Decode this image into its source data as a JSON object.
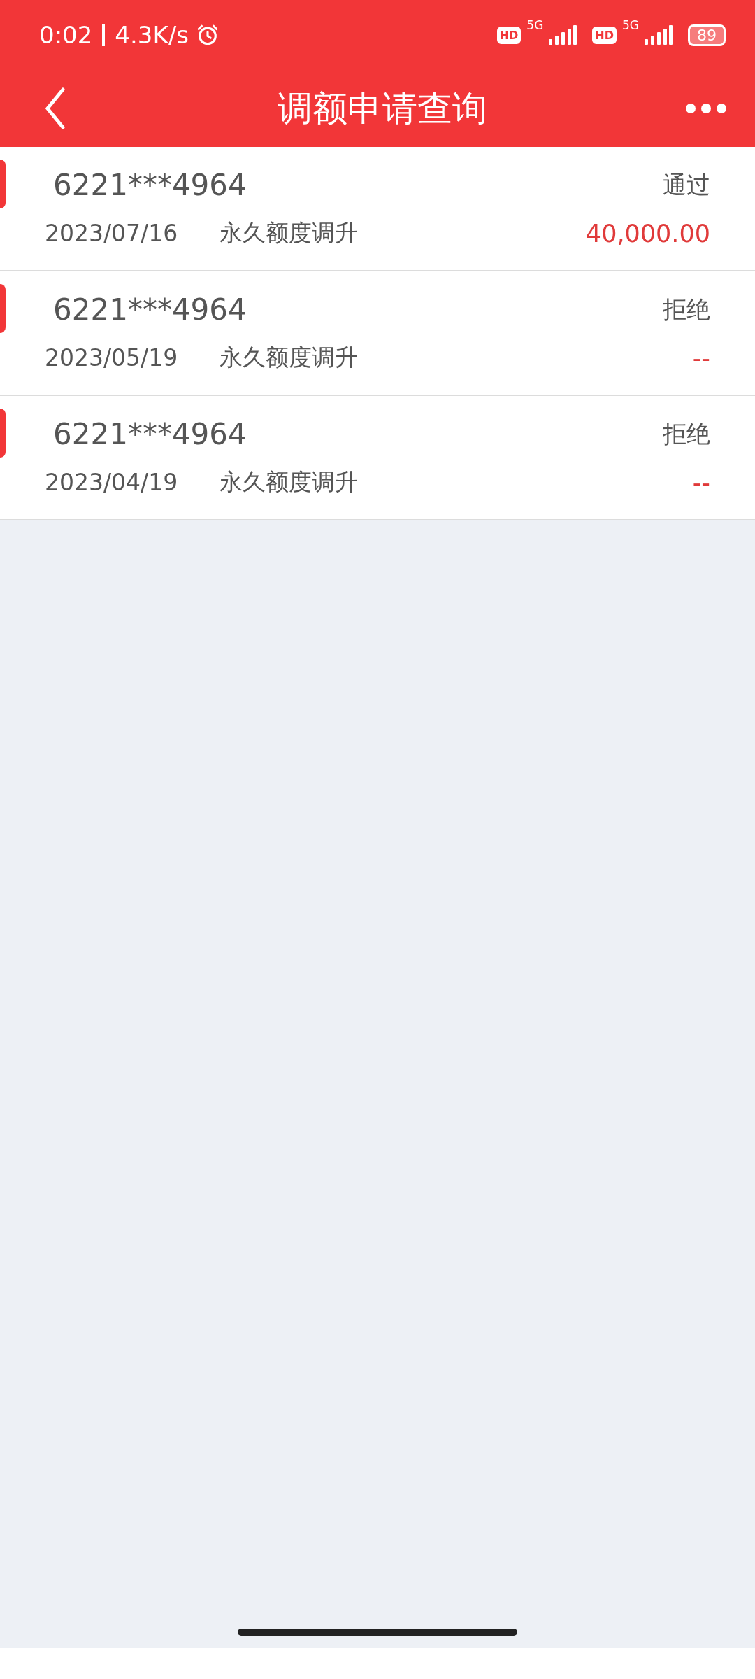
{
  "status_bar": {
    "time": "0:02",
    "speed": "4.3K/s",
    "sims": [
      {
        "hd": "HD",
        "network": "5G"
      },
      {
        "hd": "HD",
        "network": "5G"
      }
    ],
    "battery": "89"
  },
  "header": {
    "title": "调额申请查询"
  },
  "records": [
    {
      "card": "6221***4964",
      "status": "通过",
      "date": "2023/07/16",
      "type": "永久额度调升",
      "amount": "40,000.00"
    },
    {
      "card": "6221***4964",
      "status": "拒绝",
      "date": "2023/05/19",
      "type": "永久额度调升",
      "amount": "--"
    },
    {
      "card": "6221***4964",
      "status": "拒绝",
      "date": "2023/04/19",
      "type": "永久额度调升",
      "amount": "--"
    }
  ]
}
